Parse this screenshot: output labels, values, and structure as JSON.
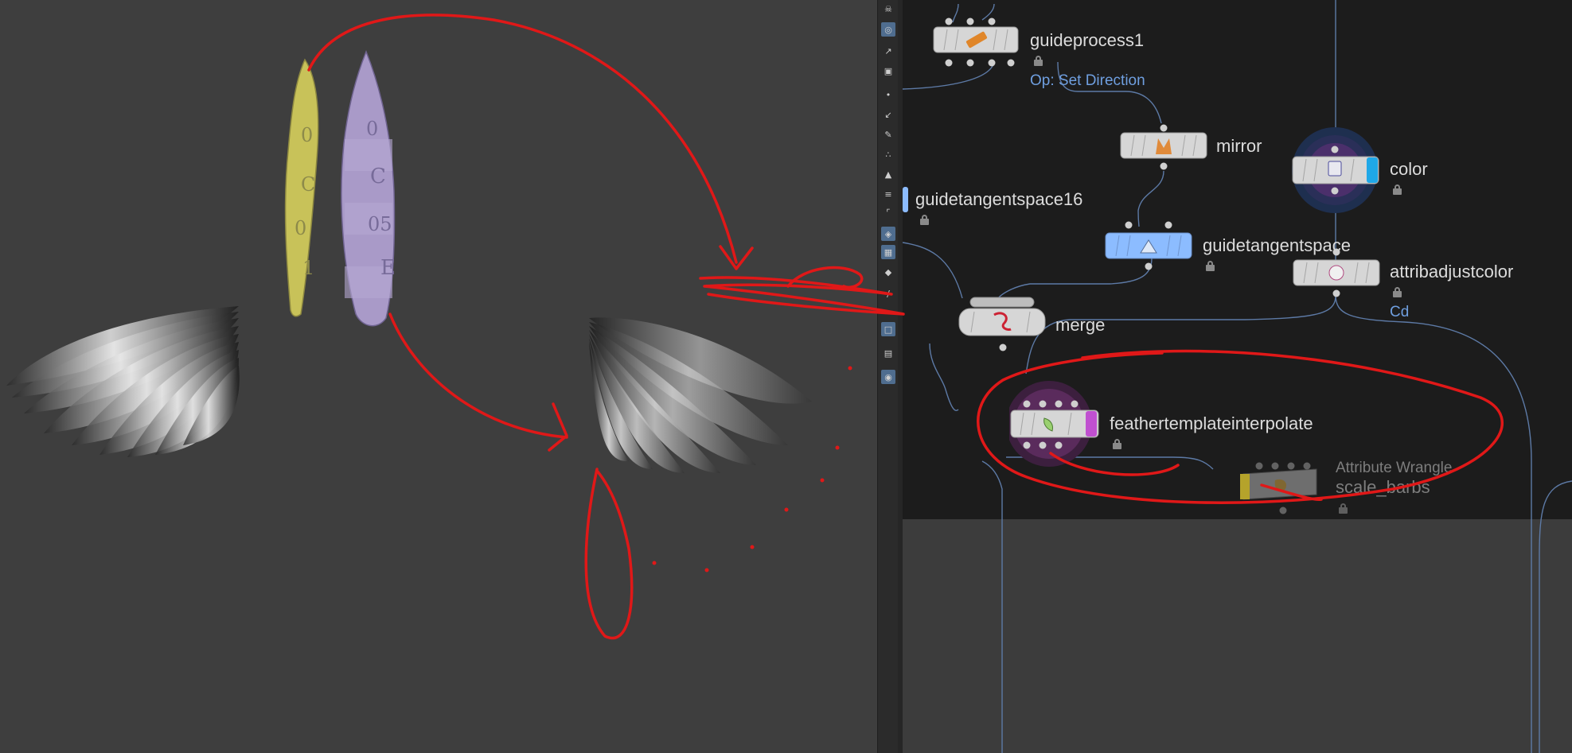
{
  "nodes": {
    "guideprocess1": {
      "label": "guideprocess1",
      "sub": "Op: Set Direction"
    },
    "mirror": {
      "label": "mirror"
    },
    "color": {
      "label": "color"
    },
    "guidetangentspace16": {
      "label": "guidetangentspace16"
    },
    "guidetangentspace": {
      "label": "guidetangentspace"
    },
    "attribadjustcolor": {
      "label": "attribadjustcolor",
      "sub": "Cd"
    },
    "merge": {
      "label": "merge"
    },
    "feathertemplateinterpolate": {
      "label": "feathertemplateinterpolate"
    },
    "wrangle": {
      "type_label": "Attribute Wrangle",
      "label": "scale_barbs"
    }
  },
  "viewport": {
    "yellow_template_glyphs": [
      "0",
      "C",
      "0",
      "1"
    ],
    "purple_template_glyphs": [
      "0",
      "C",
      "05",
      "E"
    ]
  },
  "toolbar": {
    "tools": [
      "handle-icon",
      "snap-icon",
      "select-icon",
      "view-icon",
      "point-icon",
      "brush-icon",
      "pen-icon",
      "vector-icon",
      "geometry-icon",
      "guide-icon",
      "corner-icon",
      "display-icon",
      "grid-icon",
      "shade-icon",
      "ruler-icon",
      "light-icon",
      "camera-icon",
      "pin-icon"
    ]
  },
  "colors": {
    "annotation": "#e01818",
    "node_blue": "#8cbcff",
    "flag_purple": "#c050d0",
    "flag_cyan": "#1fa8e8",
    "flag_yellow": "#e8d030",
    "template_yellow": "#c8c259",
    "template_purple": "#a99ac8",
    "wire": "#5d7aa6"
  }
}
